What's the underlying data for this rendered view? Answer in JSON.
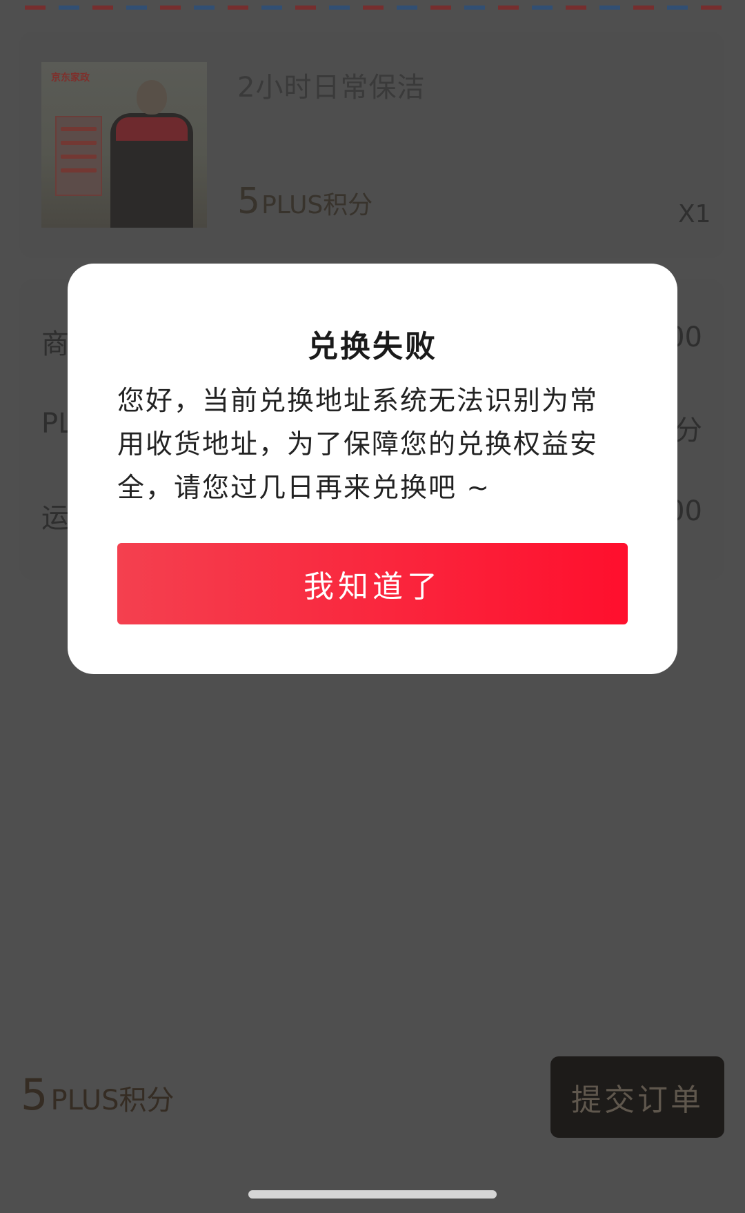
{
  "product": {
    "title": "2小时日常保洁",
    "price_number": "5",
    "price_unit": "PLUS积分",
    "quantity": "X1",
    "image": {
      "brand_text": "京东家政"
    }
  },
  "fees": {
    "rows": [
      {
        "label_partial": "商",
        "value_partial": "00"
      },
      {
        "label_partial": "PL",
        "value_partial": "分"
      },
      {
        "label_partial": "运",
        "value_partial": "00"
      }
    ]
  },
  "bottom": {
    "total_number": "5",
    "total_unit": "PLUS积分",
    "submit_label": "提交订单"
  },
  "dialog": {
    "title": "兑换失败",
    "message": "您好，当前兑换地址系统无法识别为常用收货地址，为了保障您的兑换权益安全，请您过几日再来兑换吧 ~",
    "confirm_label": "我知道了",
    "confirm_color_start": "#f4404f",
    "confirm_color_end": "#ff0f2d"
  }
}
